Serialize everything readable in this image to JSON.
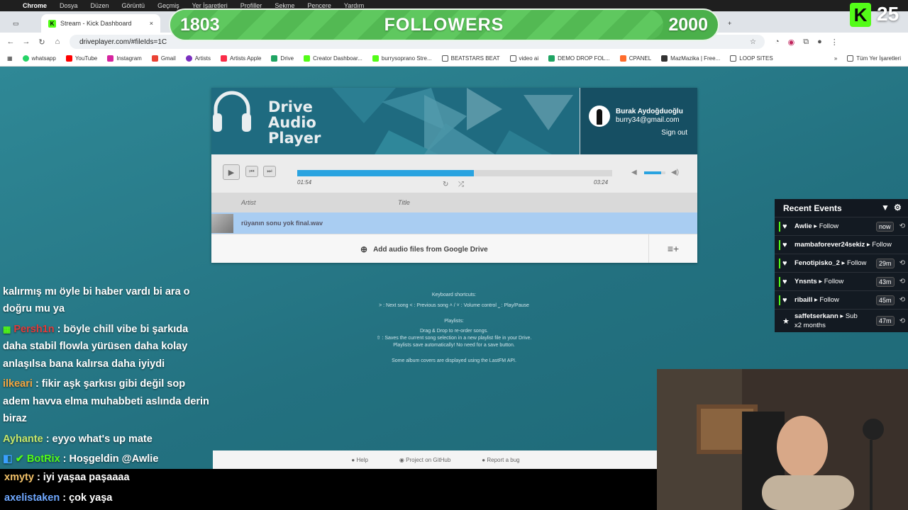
{
  "menubar": {
    "app": "Chrome",
    "items": [
      "Dosya",
      "Düzen",
      "Görüntü",
      "Geçmiş",
      "Yer İşaretleri",
      "Profiller",
      "Sekme",
      "Pencere",
      "Yardım"
    ]
  },
  "tabs": [
    {
      "label": "Stream - Kick Dashboard"
    }
  ],
  "address": {
    "url": "driveplayer.com/#fileIds=1C"
  },
  "bookmarks": [
    "whatsapp",
    "YouTube",
    "Instagram",
    "Gmail",
    "Artists",
    "Artists Apple",
    "Drive",
    "Creator Dashboar...",
    "burrysoprano Stre...",
    "BEATSTARS BEAT",
    "video ai",
    "DEMO DROP FOL...",
    "CPANEL",
    "MazMazika | Free...",
    "LOOP SITES"
  ],
  "bookmarks_right": "Tüm Yer İşaretleri",
  "goal": {
    "current": "1803",
    "label": "FOLLOWERS",
    "target": "2000",
    "progress": 0.9
  },
  "kick_viewers": {
    "badge": "K",
    "count": "25"
  },
  "player": {
    "logo_lines": [
      "Drive",
      "Audio",
      "Player"
    ],
    "user_name": "Burak Aydoğduoğlu",
    "user_email": "burry34@gmail.com",
    "sign_out": "Sign out",
    "time_current": "01:54",
    "time_total": "03:24",
    "progress": 0.56,
    "volume": 0.8,
    "col_artist": "Artist",
    "col_title": "Title",
    "track": "rüyanın sonu yok final.wav",
    "add_label": "Add audio files from Google Drive"
  },
  "info": {
    "shortcuts_title": "Keyboard shortcuts:",
    "shortcuts": "˃ : Next song  ˂ : Previous song  ˄ / ˅ : Volume control  ⎵ : Play/Pause",
    "playlists_title": "Playlists:",
    "pl1": "Drag & Drop to re-order songs.",
    "pl2": "⇧ : Saves the current song selection in a new playlist file in your Drive.",
    "pl3": "Playlists save automatically! No need for a save button.",
    "lastfm": "Some album covers are displayed using the LastFM API."
  },
  "footer": {
    "help": "Help",
    "github": "Project on GitHub",
    "bug": "Report a bug"
  },
  "chat": [
    {
      "user": "",
      "text": "kalırmış mı öyle bi haber vardı bi ara o",
      "color": "#ffffff"
    },
    {
      "user": "",
      "text": "doğru mu ya",
      "color": "#ffffff"
    },
    {
      "user": "Persh1n",
      "text": " : böyle chill vibe bi şarkıda daha stabil flowla yürüsen daha kolay anlaşılsa bana kalırsa daha iyiydi",
      "color": "#ff4d4d"
    },
    {
      "user": "ilkeari",
      "text": " : fikir aşk şarkısı gibi değil sop adem havva elma muhabbeti aslında derin biraz",
      "color": "#f4a640"
    },
    {
      "user": "Ayhante",
      "text": " : eyyo what's up mate",
      "color": "#c8e86a"
    },
    {
      "user": "BotRix",
      "text": " : Hoşgeldin @Awlie",
      "color": "#53fc18"
    }
  ],
  "chat_dark": [
    {
      "user": "xmyty",
      "text": " : iyi yaşaa paşaaaa",
      "color": "#f4c36a"
    },
    {
      "user": "axelistaken",
      "text": " : çok yaşa",
      "color": "#6fa8ff"
    }
  ],
  "events": {
    "title": "Recent Events",
    "rows": [
      {
        "name": "Awlie",
        "action": "Follow",
        "time": "now",
        "icon": "heart-icon"
      },
      {
        "name": "mambaforever24sekiz",
        "action": "Follow",
        "time": "",
        "icon": "heart-icon"
      },
      {
        "name": "Fenotipisko_2",
        "action": "Follow",
        "time": "29m",
        "icon": "heart-icon"
      },
      {
        "name": "Ynsnts",
        "action": "Follow",
        "time": "43m",
        "icon": "heart-icon"
      },
      {
        "name": "ribaill",
        "action": "Follow",
        "time": "45m",
        "icon": "heart-icon"
      },
      {
        "name": "saffetserkann",
        "action": "Sub",
        "extra": "x2 months",
        "time": "47m",
        "icon": "star-icon"
      }
    ]
  },
  "colors": {
    "accent_blue": "#29a3e0",
    "kick_green": "#53fc18",
    "page_teal": "#2a7d8c"
  }
}
